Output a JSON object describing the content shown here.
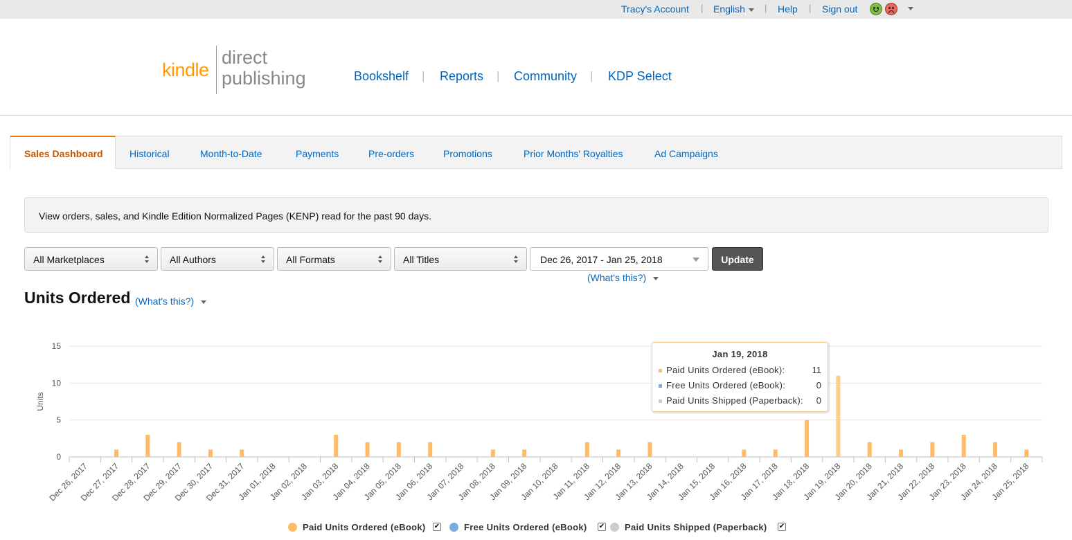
{
  "topbar": {
    "account": "Tracy's Account",
    "language": "English",
    "help": "Help",
    "signout": "Sign out"
  },
  "logo": {
    "kindle": "kindle",
    "direct": "direct",
    "publishing": "publishing"
  },
  "nav": {
    "bookshelf": "Bookshelf",
    "reports": "Reports",
    "community": "Community",
    "kdp_select": "KDP Select",
    "separator": "|"
  },
  "tabs": [
    {
      "label": "Sales Dashboard"
    },
    {
      "label": "Historical"
    },
    {
      "label": "Month-to-Date"
    },
    {
      "label": "Payments"
    },
    {
      "label": "Pre-orders"
    },
    {
      "label": "Promotions"
    },
    {
      "label": "Prior Months' Royalties"
    },
    {
      "label": "Ad Campaigns"
    }
  ],
  "info_text": "View orders, sales, and Kindle Edition Normalized Pages (KENP) read for the past 90 days.",
  "filters": {
    "marketplaces": "All Marketplaces",
    "authors": "All Authors",
    "formats": "All Formats",
    "titles": "All Titles",
    "date_range": "Dec 26, 2017 - Jan 25, 2018",
    "update": "Update",
    "whats_this": "(What's this?)"
  },
  "section": {
    "title": "Units Ordered",
    "whats_this": "(What's this?)"
  },
  "colors": {
    "paid": "#ffbb66",
    "free": "#7aaae0",
    "paperback": "#cccccc",
    "link": "#0066c0",
    "accent": "#e47911"
  },
  "tooltip": {
    "date": "Jan 19, 2018",
    "rows": [
      {
        "label": "Paid Units Ordered (eBook):",
        "value": "11"
      },
      {
        "label": "Free Units Ordered (eBook):",
        "value": "0"
      },
      {
        "label": "Paid Units Shipped (Paperback):",
        "value": "0"
      }
    ]
  },
  "legend_check": "✔",
  "chart_data": {
    "type": "bar",
    "ylabel": "Units",
    "ylim": [
      0,
      15
    ],
    "yticks": [
      0,
      5,
      10,
      15
    ],
    "grid": true,
    "legend": "bottom",
    "categories": [
      "Dec 26, 2017",
      "Dec 27, 2017",
      "Dec 28, 2017",
      "Dec 29, 2017",
      "Dec 30, 2017",
      "Dec 31, 2017",
      "Jan 01, 2018",
      "Jan 02, 2018",
      "Jan 03, 2018",
      "Jan 04, 2018",
      "Jan 05, 2018",
      "Jan 06, 2018",
      "Jan 07, 2018",
      "Jan 08, 2018",
      "Jan 09, 2018",
      "Jan 10, 2018",
      "Jan 11, 2018",
      "Jan 12, 2018",
      "Jan 13, 2018",
      "Jan 14, 2018",
      "Jan 15, 2018",
      "Jan 16, 2018",
      "Jan 17, 2018",
      "Jan 18, 2018",
      "Jan 19, 2018",
      "Jan 20, 2018",
      "Jan 21, 2018",
      "Jan 22, 2018",
      "Jan 23, 2018",
      "Jan 24, 2018",
      "Jan 25, 2018"
    ],
    "series": [
      {
        "name": "Paid Units Ordered (eBook)",
        "values": [
          0,
          1,
          3,
          2,
          1,
          1,
          0,
          0,
          3,
          2,
          2,
          2,
          0,
          1,
          1,
          0,
          2,
          1,
          2,
          0,
          0,
          1,
          1,
          5,
          11,
          2,
          1,
          2,
          3,
          2,
          1
        ]
      },
      {
        "name": "Free Units Ordered (eBook)",
        "values": [
          0,
          0,
          0,
          0,
          0,
          0,
          0,
          0,
          0,
          0,
          0,
          0,
          0,
          0,
          0,
          0,
          0,
          0,
          0,
          0,
          0,
          0,
          0,
          0,
          0,
          0,
          0,
          0,
          0,
          0,
          0
        ]
      },
      {
        "name": "Paid Units Shipped (Paperback)",
        "values": [
          0,
          0,
          0,
          0,
          0,
          0,
          0,
          0,
          0,
          0,
          0,
          0,
          0,
          0,
          0,
          0,
          0,
          0,
          0,
          0,
          0,
          0,
          0,
          0,
          0,
          0,
          0,
          0,
          0,
          0,
          0
        ]
      }
    ]
  }
}
